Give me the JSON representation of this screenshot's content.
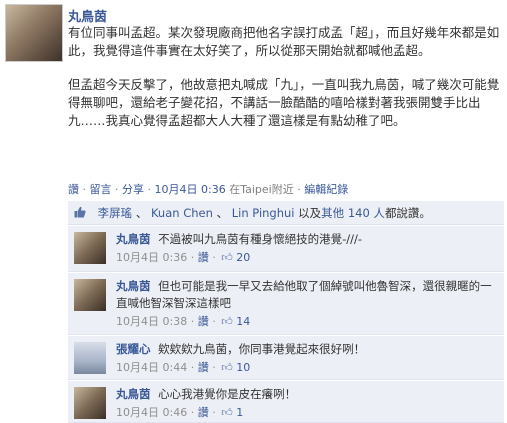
{
  "post": {
    "author": "丸鳥茵",
    "paragraph1": "有位同事叫孟超。某次發現廠商把他名字誤打成孟「超」，而且好幾年來都是如此，我覺得這件事實在太好笑了，所以從那天開始就都喊他孟超。",
    "paragraph2": "但孟超今天反擊了，他故意把丸喊成「九」，一直叫我九鳥茵，喊了幾次可能覺得無聊吧，還給老子變花招，不講話一臉酷酷的嘻哈樣對著我張開雙手比出九……我真心覺得孟超都大人大種了還這樣是有點幼稚了吧。",
    "meta": {
      "like": "讚",
      "comment": "留言",
      "share": "分享",
      "sep": "·",
      "time": "10月4日 0:36",
      "location": "在Taipei附近",
      "edit_history": "編輯紀錄"
    }
  },
  "likes": {
    "thumb_icon": "thumbs-up-icon",
    "names": [
      "李屏瑤",
      "Kuan Chen",
      "Lin Pinghui"
    ],
    "sep": "、",
    "and_text": "以及",
    "others": "其他 140 人",
    "suffix": "都說讚。"
  },
  "comments": [
    {
      "name": "丸鳥茵",
      "text": "不過被叫九鳥茵有種身懷絕技的港覺-///-",
      "time": "10月4日 0:36",
      "likes": "20"
    },
    {
      "name": "丸鳥茵",
      "text": "但也可能是我一早又去給他取了個綽號叫他魯智深，還很親暱的一直喊他智深智深這樣吧",
      "time": "10月4日 0:38",
      "likes": "14"
    },
    {
      "name": "張耀心",
      "text": "欸欸欸九鳥菌，你同事港覺起來很好咧！",
      "time": "10月4日 0:44",
      "likes": "10"
    },
    {
      "name": "丸鳥茵",
      "text": "心心我港覺你是皮在癢咧！",
      "time": "10月4日 0:46",
      "likes": "1"
    }
  ],
  "comment_like_label": "讚",
  "comment_sep": "·"
}
